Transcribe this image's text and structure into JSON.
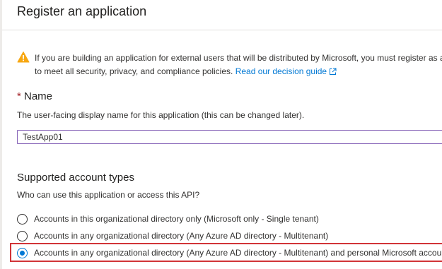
{
  "header": {
    "title": "Register an application"
  },
  "notice": {
    "icon": "warning-icon",
    "line1": "If you are building an application for external users that will be distributed by Microsoft, you must register as a firs",
    "line2": "to meet all security, privacy, and compliance policies.",
    "link_label": "Read our decision guide",
    "link_icon": "external-link-icon"
  },
  "name_section": {
    "required_mark": "*",
    "label": "Name",
    "description": "The user-facing display name for this application (this can be changed later).",
    "value": "TestApp01"
  },
  "account_types": {
    "title": "Supported account types",
    "question": "Who can use this application or access this API?",
    "options": [
      {
        "label": "Accounts in this organizational directory only (Microsoft only - Single tenant)",
        "selected": false
      },
      {
        "label": "Accounts in any organizational directory (Any Azure AD directory - Multitenant)",
        "selected": false
      },
      {
        "label": "Accounts in any organizational directory (Any Azure AD directory - Multitenant) and personal Microsoft accounts (",
        "selected": true
      }
    ]
  },
  "colors": {
    "accent": "#0078d4",
    "warning": "#f7a711",
    "highlight": "#d13438",
    "input_border": "#8764b8"
  }
}
